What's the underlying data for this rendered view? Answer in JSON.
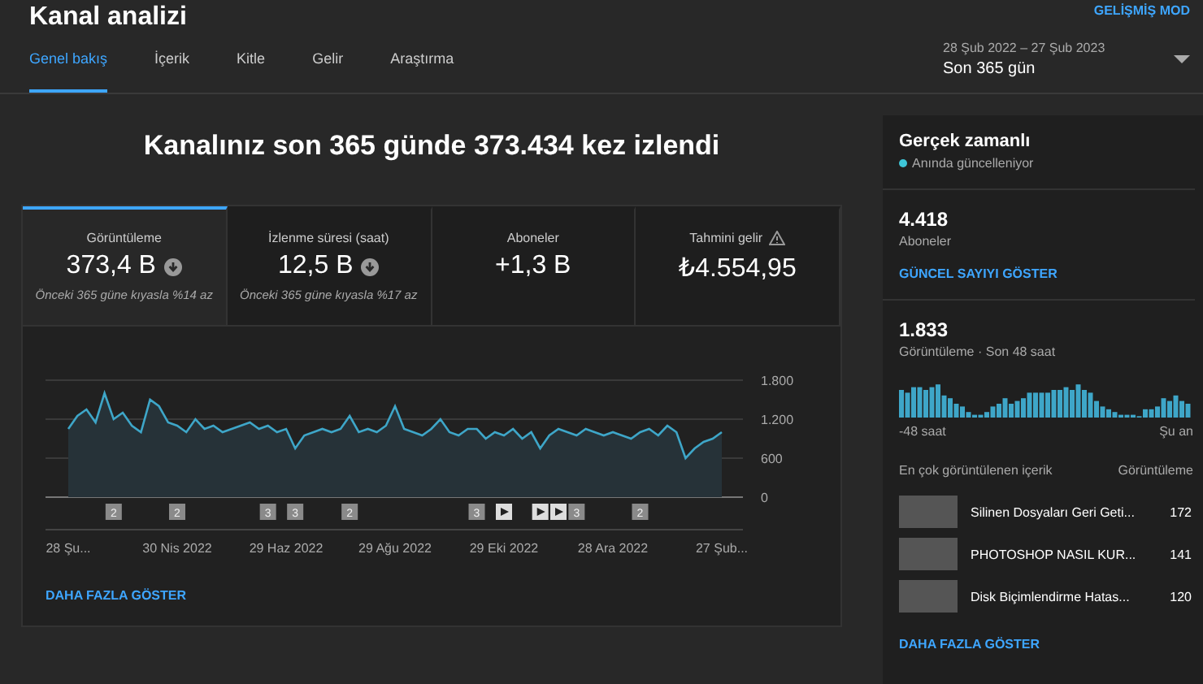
{
  "header": {
    "title": "Kanal analizi",
    "advanced_mode": "GELİŞMİŞ MOD",
    "date_range": "28 Şub 2022 – 27 Şub 2023",
    "period": "Son 365 gün"
  },
  "tabs": [
    {
      "label": "Genel bakış",
      "selected": true
    },
    {
      "label": "İçerik",
      "selected": false
    },
    {
      "label": "Kitle",
      "selected": false
    },
    {
      "label": "Gelir",
      "selected": false
    },
    {
      "label": "Araştırma",
      "selected": false
    }
  ],
  "headline": "Kanalınız son 365 günde 373.434 kez izlendi",
  "metrics": [
    {
      "label": "Görüntüleme",
      "value": "373,4 B",
      "decreased": true,
      "note": "Önceki 365 güne kıyasla %14 az",
      "warning": false,
      "selected": true
    },
    {
      "label": "İzlenme süresi (saat)",
      "value": "12,5 B",
      "decreased": true,
      "note": "Önceki 365 güne kıyasla %17 az",
      "warning": false,
      "selected": false
    },
    {
      "label": "Aboneler",
      "value": "+1,3 B",
      "decreased": false,
      "warning": false,
      "selected": false
    },
    {
      "label": "Tahmini gelir",
      "value": "₺4.554,95",
      "decreased": false,
      "warning": true,
      "selected": false
    }
  ],
  "chart_data": {
    "type": "area",
    "categories": [
      "28 Şu...",
      null,
      null,
      null,
      null,
      null,
      null,
      null,
      null,
      null,
      null,
      null,
      "30 Nis 2022",
      null,
      null,
      null,
      null,
      null,
      null,
      null,
      null,
      null,
      null,
      null,
      "29 Haz 2022",
      null,
      null,
      null,
      null,
      null,
      null,
      null,
      null,
      null,
      null,
      null,
      "29 Ağu 2022",
      null,
      null,
      null,
      null,
      null,
      null,
      null,
      null,
      null,
      null,
      null,
      "29 Eki 2022",
      null,
      null,
      null,
      null,
      null,
      null,
      null,
      null,
      null,
      null,
      null,
      "28 Ara 2022",
      null,
      null,
      null,
      null,
      null,
      null,
      null,
      null,
      null,
      null,
      null,
      "27 Şub..."
    ],
    "series": [
      {
        "color": "#3ea6c8",
        "values": [
          1050,
          1250,
          1350,
          1150,
          1600,
          1200,
          1300,
          1100,
          1000,
          1500,
          1400,
          1150,
          1100,
          1000,
          1200,
          1050,
          1100,
          1000,
          1050,
          1100,
          1150,
          1050,
          1100,
          1000,
          1050,
          750,
          950,
          1000,
          1050,
          1000,
          1050,
          1250,
          1000,
          1050,
          1000,
          1100,
          1400,
          1050,
          1000,
          950,
          1050,
          1200,
          1000,
          950,
          1050,
          1050,
          900,
          1000,
          950,
          1050,
          900,
          1000,
          750,
          950,
          1050,
          1000,
          950,
          1050,
          1000,
          950,
          1000,
          950,
          900,
          1000,
          1050,
          950,
          1100,
          1000,
          600,
          750,
          850,
          900,
          1000
        ]
      }
    ],
    "ylim": [
      0,
      1800
    ],
    "yticks": [
      {
        "value": 0,
        "label": "0"
      },
      {
        "value": 600,
        "label": "600"
      },
      {
        "value": 1200,
        "label": "1.200"
      },
      {
        "value": 1800,
        "label": "1.800"
      }
    ]
  },
  "chart_markers": [
    {
      "kind": "count",
      "label": "2"
    },
    {
      "kind": "count",
      "label": "2"
    },
    {
      "kind": "count",
      "label": "3"
    },
    {
      "kind": "count",
      "label": "3"
    },
    {
      "kind": "count",
      "label": "2"
    },
    {
      "kind": "count",
      "label": "3"
    },
    {
      "kind": "video"
    },
    {
      "kind": "video"
    },
    {
      "kind": "video"
    },
    {
      "kind": "count",
      "label": "3"
    },
    {
      "kind": "count",
      "label": "2"
    }
  ],
  "show_more": "DAHA FAZLA GÖSTER",
  "realtime": {
    "title": "Gerçek zamanlı",
    "live_label": "Anında güncelleniyor",
    "subscribers": "4.418",
    "subscribers_label": "Aboneler",
    "show_count": "GÜNCEL SAYIYI GÖSTER",
    "views": "1.833",
    "views_label": "Görüntüleme · Son 48 saat",
    "axis_start": "-48 saat",
    "axis_end": "Şu an",
    "top_heading": "En çok görüntülenen içerik",
    "top_column": "Görüntüleme",
    "top_content": [
      {
        "title": "Silinen Dosyaları Geri Geti...",
        "views": "172"
      },
      {
        "title": "PHOTOSHOP NASIL KUR...",
        "views": "141"
      },
      {
        "title": "Disk Biçimlendirme Hatas...",
        "views": "120"
      }
    ],
    "show_more": "DAHA FAZLA GÖSTER"
  }
}
